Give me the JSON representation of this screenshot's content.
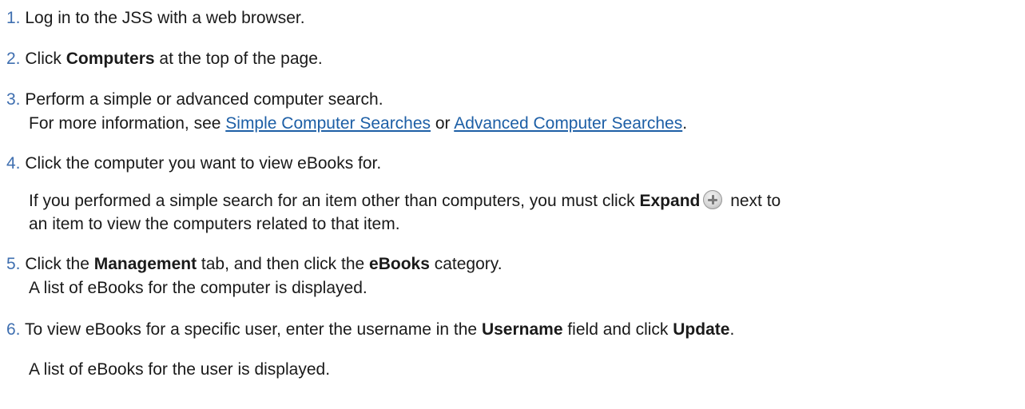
{
  "steps": [
    {
      "num": "1.",
      "text": "Log in to the JSS with a web browser."
    },
    {
      "num": "2.",
      "pre": "Click ",
      "bold": "Computers",
      "post": " at the top of the page."
    },
    {
      "num": "3.",
      "text": "Perform a simple or advanced computer search.",
      "more_pre": "For more information, see ",
      "link1": "Simple Computer Searches",
      "mid": " or ",
      "link2": "Advanced Computer Searches",
      "end": "."
    },
    {
      "num": "4.",
      "text": "Click the computer you want to view eBooks for.",
      "note_pre": "If you performed a simple search for an item other than computers, you must click ",
      "note_bold": "Expand",
      "note_post": " next to",
      "note_line2": "an item to view the computers related to that item.",
      "icon": "expand-plus-icon"
    },
    {
      "num": "5.",
      "pre": "Click the ",
      "bold1": "Management",
      "mid": " tab, and then click the ",
      "bold2": "eBooks",
      "post": " category.",
      "line2": "A list of eBooks for the computer is displayed."
    },
    {
      "num": "6.",
      "pre": "To view eBooks for a specific user, enter the username in the ",
      "bold1": "Username",
      "mid": " field and click ",
      "bold2": "Update",
      "post": ".",
      "result": "A list of eBooks for the user is displayed."
    }
  ],
  "colors": {
    "text": "#1a1a1a",
    "step_number": "#3f6fb0",
    "link": "#1d5fa6"
  }
}
